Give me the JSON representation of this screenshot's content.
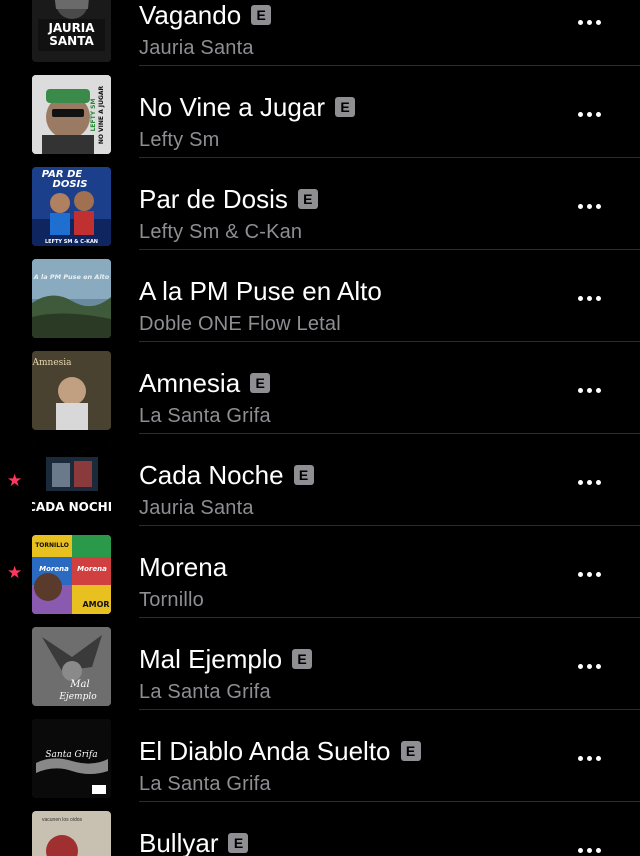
{
  "colors": {
    "background": "#000000",
    "title": "#ffffff",
    "subtitle": "#8e8e93",
    "favorite_star": "#ff375f",
    "explicit_badge": "#8e8e93"
  },
  "explicit_label": "E",
  "tracks": [
    {
      "title": "Vagando",
      "artist": "Jauria Santa",
      "explicit": true,
      "favorite": false,
      "art_text": [
        "JAURIA",
        "SANTA"
      ]
    },
    {
      "title": "No Vine a Jugar",
      "artist": "Lefty Sm",
      "explicit": true,
      "favorite": false,
      "art_text": [
        "NO VINE A JUGAR",
        "LEFTY SM"
      ]
    },
    {
      "title": "Par de Dosis",
      "artist": "Lefty Sm & C-Kan",
      "explicit": true,
      "favorite": false,
      "art_text": [
        "PAR DE",
        "DOSIS",
        "LEFTY SM & C-KAN"
      ]
    },
    {
      "title": "A la PM Puse en Alto",
      "artist": "Doble ONE Flow Letal",
      "explicit": false,
      "favorite": false,
      "art_text": [
        "A la PM Puse en Alto"
      ]
    },
    {
      "title": "Amnesia",
      "artist": "La Santa Grifa",
      "explicit": true,
      "favorite": false,
      "art_text": [
        "Amnesia"
      ]
    },
    {
      "title": "Cada Noche",
      "artist": "Jauria Santa",
      "explicit": true,
      "favorite": true,
      "art_text": [
        "CADA NOCHE"
      ]
    },
    {
      "title": "Morena",
      "artist": "Tornillo",
      "explicit": false,
      "favorite": true,
      "art_text": [
        "TORNILLO",
        "Morena",
        "Morena",
        "AMOR"
      ]
    },
    {
      "title": "Mal Ejemplo",
      "artist": "La Santa Grifa",
      "explicit": true,
      "favorite": false,
      "art_text": [
        "Mal",
        "Ejemplo"
      ]
    },
    {
      "title": "El Diablo Anda Suelto",
      "artist": "La Santa Grifa",
      "explicit": true,
      "favorite": false,
      "art_text": [
        "Santa Grifa"
      ]
    },
    {
      "title": "Bullyar",
      "artist": "",
      "explicit": true,
      "favorite": false,
      "art_text": [
        "vacunen los oidos"
      ]
    }
  ]
}
